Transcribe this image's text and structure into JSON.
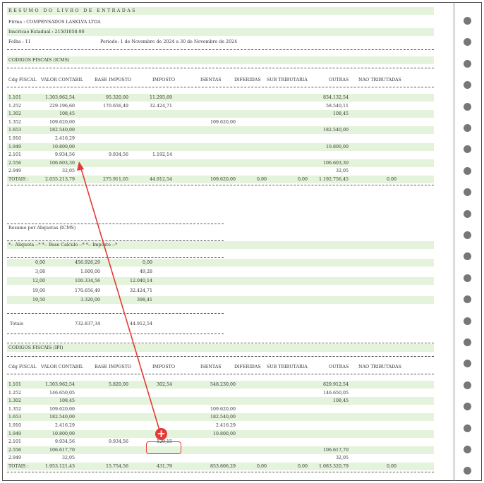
{
  "header": {
    "title": "RESUMO DO LIVRO DE ENTRADAS",
    "firma": "Firma :   COMPENSADOS LASKLVA LTDA",
    "inscricao": "Inscricao Estadual : 21501058-90",
    "folha": "Folha :   11",
    "periodo": "Periodo:     1 de Novembro de 2024 a 30 de Novembro de 2024"
  },
  "icms": {
    "section_title": "CODIGOS FISCAIS (ICMS)",
    "columns": [
      "Cdg FISCAL",
      "VALOR CONTABIL",
      "BASE IMPOSTO",
      "IMPOSTO",
      "ISENTAS",
      "DIFERIDAS",
      "SUB TRIBUTARIA",
      "OUTRAS",
      "NAO TRIBUTADAS"
    ],
    "rows": [
      [
        "1.101",
        "1.303.962,54",
        "95.320,00",
        "11.295,69",
        "",
        "",
        "",
        "834.132,54",
        ""
      ],
      [
        "1.252",
        "229.196,60",
        "170.656,49",
        "32.424,71",
        "",
        "",
        "",
        "58.540,11",
        ""
      ],
      [
        "1.302",
        "108,45",
        "",
        "",
        "",
        "",
        "",
        "108,45",
        ""
      ],
      [
        "1.352",
        "109.620,00",
        "",
        "",
        "109.620,00",
        "",
        "",
        "",
        ""
      ],
      [
        "1.653",
        "182.540,00",
        "",
        "",
        "",
        "",
        "",
        "182.540,00",
        ""
      ],
      [
        "1.910",
        "2.416,29",
        "",
        "",
        "",
        "",
        "",
        "",
        ""
      ],
      [
        "1.949",
        "10.800,00",
        "",
        "",
        "",
        "",
        "",
        "10.800,00",
        ""
      ],
      [
        "2.101",
        "9.934,56",
        "9.934,56",
        "1.192,14",
        "",
        "",
        "",
        "",
        ""
      ],
      [
        "2.556",
        "106.603,30",
        "",
        "",
        "",
        "",
        "",
        "106.603,30",
        ""
      ],
      [
        "2.949",
        "32,05",
        "",
        "",
        "",
        "",
        "",
        "32,05",
        ""
      ]
    ],
    "totals": [
      "TOTAIS :",
      "2.035.213,79",
      "275.911,05",
      "44.912,54",
      "109.620,00",
      "0,00",
      "0,00",
      "1.192.756,45",
      "0,00"
    ]
  },
  "aliquotas": {
    "title": "Resumo por Aliquotas (ICMS)",
    "header": "*-- Aliquota --* *-- Base Calculo --* *-- Imposto --*",
    "rows": [
      [
        "0,00",
        "456.926,29",
        "0,00"
      ],
      [
        "3,08",
        "1.600,00",
        "49,28"
      ],
      [
        "12,00",
        "100.334,56",
        "12.040,14"
      ],
      [
        "19,00",
        "170.656,49",
        "32.424,71"
      ],
      [
        "19,50",
        "3.320,00",
        "398,41"
      ]
    ],
    "total": [
      "Totais",
      "732.837,34",
      "44.912,54"
    ]
  },
  "ipi": {
    "section_title": "CODIGOS FISCAIS (IPI)",
    "columns": [
      "Cdg FISCAL",
      "VALOR CONTABIL",
      "BASE IMPOSTO",
      "IMPOSTO",
      "ISENTAS",
      "DIFERIDAS",
      "SUB TRIBUTARIA",
      "OUTRAS",
      "NAO TRIBUTADAS"
    ],
    "rows": [
      [
        "1.101",
        "1.303.962,54",
        "5.820,00",
        "302,54",
        "548.230,00",
        "",
        "",
        "829.912,54",
        ""
      ],
      [
        "1.252",
        "146.650,05",
        "",
        "",
        "",
        "",
        "",
        "146.650,05",
        ""
      ],
      [
        "1.302",
        "108,45",
        "",
        "",
        "",
        "",
        "",
        "108,45",
        ""
      ],
      [
        "1.352",
        "109.620,00",
        "",
        "",
        "109.620,00",
        "",
        "",
        "",
        ""
      ],
      [
        "1.653",
        "182.540,00",
        "",
        "",
        "182.540,00",
        "",
        "",
        "",
        ""
      ],
      [
        "1.910",
        "2.416,29",
        "",
        "",
        "2.416,29",
        "",
        "",
        "",
        ""
      ],
      [
        "1.949",
        "10.800,00",
        "",
        "",
        "10.800,00",
        "",
        "",
        "",
        ""
      ],
      [
        "2.101",
        "9.934,56",
        "9.934,56",
        "129,15",
        "",
        "",
        "",
        "",
        ""
      ],
      [
        "2.556",
        "106.617,70",
        "",
        "",
        "",
        "",
        "",
        "106.617,70",
        ""
      ],
      [
        "2.949",
        "32,05",
        "",
        "",
        "",
        "",
        "",
        "32,05",
        ""
      ]
    ],
    "totals": [
      "TOTAIS :",
      "1.953.121,43",
      "15.754,56",
      "431,79",
      "853.606,29",
      "0,00",
      "0,00",
      "1.083.320,79",
      "0,00"
    ]
  },
  "colors": {
    "stripe": "#e4f3dc",
    "annotation": "#e53935"
  },
  "icons": {
    "annotation_marker": "plus-circle-icon",
    "feed_hole": "tractor-hole-icon"
  }
}
